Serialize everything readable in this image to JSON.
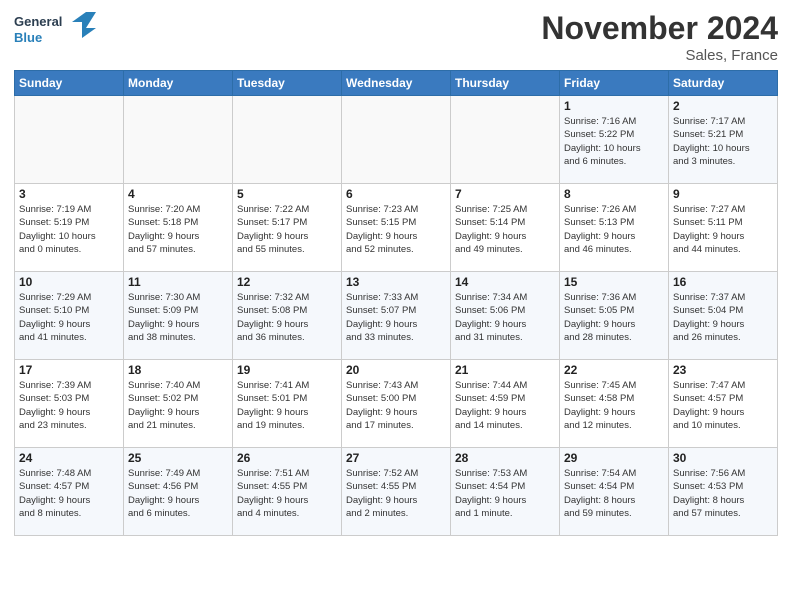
{
  "logo": {
    "line1": "General",
    "line2": "Blue"
  },
  "header": {
    "month": "November 2024",
    "location": "Sales, France"
  },
  "weekdays": [
    "Sunday",
    "Monday",
    "Tuesday",
    "Wednesday",
    "Thursday",
    "Friday",
    "Saturday"
  ],
  "weeks": [
    [
      {
        "day": "",
        "info": ""
      },
      {
        "day": "",
        "info": ""
      },
      {
        "day": "",
        "info": ""
      },
      {
        "day": "",
        "info": ""
      },
      {
        "day": "",
        "info": ""
      },
      {
        "day": "1",
        "info": "Sunrise: 7:16 AM\nSunset: 5:22 PM\nDaylight: 10 hours\nand 6 minutes."
      },
      {
        "day": "2",
        "info": "Sunrise: 7:17 AM\nSunset: 5:21 PM\nDaylight: 10 hours\nand 3 minutes."
      }
    ],
    [
      {
        "day": "3",
        "info": "Sunrise: 7:19 AM\nSunset: 5:19 PM\nDaylight: 10 hours\nand 0 minutes."
      },
      {
        "day": "4",
        "info": "Sunrise: 7:20 AM\nSunset: 5:18 PM\nDaylight: 9 hours\nand 57 minutes."
      },
      {
        "day": "5",
        "info": "Sunrise: 7:22 AM\nSunset: 5:17 PM\nDaylight: 9 hours\nand 55 minutes."
      },
      {
        "day": "6",
        "info": "Sunrise: 7:23 AM\nSunset: 5:15 PM\nDaylight: 9 hours\nand 52 minutes."
      },
      {
        "day": "7",
        "info": "Sunrise: 7:25 AM\nSunset: 5:14 PM\nDaylight: 9 hours\nand 49 minutes."
      },
      {
        "day": "8",
        "info": "Sunrise: 7:26 AM\nSunset: 5:13 PM\nDaylight: 9 hours\nand 46 minutes."
      },
      {
        "day": "9",
        "info": "Sunrise: 7:27 AM\nSunset: 5:11 PM\nDaylight: 9 hours\nand 44 minutes."
      }
    ],
    [
      {
        "day": "10",
        "info": "Sunrise: 7:29 AM\nSunset: 5:10 PM\nDaylight: 9 hours\nand 41 minutes."
      },
      {
        "day": "11",
        "info": "Sunrise: 7:30 AM\nSunset: 5:09 PM\nDaylight: 9 hours\nand 38 minutes."
      },
      {
        "day": "12",
        "info": "Sunrise: 7:32 AM\nSunset: 5:08 PM\nDaylight: 9 hours\nand 36 minutes."
      },
      {
        "day": "13",
        "info": "Sunrise: 7:33 AM\nSunset: 5:07 PM\nDaylight: 9 hours\nand 33 minutes."
      },
      {
        "day": "14",
        "info": "Sunrise: 7:34 AM\nSunset: 5:06 PM\nDaylight: 9 hours\nand 31 minutes."
      },
      {
        "day": "15",
        "info": "Sunrise: 7:36 AM\nSunset: 5:05 PM\nDaylight: 9 hours\nand 28 minutes."
      },
      {
        "day": "16",
        "info": "Sunrise: 7:37 AM\nSunset: 5:04 PM\nDaylight: 9 hours\nand 26 minutes."
      }
    ],
    [
      {
        "day": "17",
        "info": "Sunrise: 7:39 AM\nSunset: 5:03 PM\nDaylight: 9 hours\nand 23 minutes."
      },
      {
        "day": "18",
        "info": "Sunrise: 7:40 AM\nSunset: 5:02 PM\nDaylight: 9 hours\nand 21 minutes."
      },
      {
        "day": "19",
        "info": "Sunrise: 7:41 AM\nSunset: 5:01 PM\nDaylight: 9 hours\nand 19 minutes."
      },
      {
        "day": "20",
        "info": "Sunrise: 7:43 AM\nSunset: 5:00 PM\nDaylight: 9 hours\nand 17 minutes."
      },
      {
        "day": "21",
        "info": "Sunrise: 7:44 AM\nSunset: 4:59 PM\nDaylight: 9 hours\nand 14 minutes."
      },
      {
        "day": "22",
        "info": "Sunrise: 7:45 AM\nSunset: 4:58 PM\nDaylight: 9 hours\nand 12 minutes."
      },
      {
        "day": "23",
        "info": "Sunrise: 7:47 AM\nSunset: 4:57 PM\nDaylight: 9 hours\nand 10 minutes."
      }
    ],
    [
      {
        "day": "24",
        "info": "Sunrise: 7:48 AM\nSunset: 4:57 PM\nDaylight: 9 hours\nand 8 minutes."
      },
      {
        "day": "25",
        "info": "Sunrise: 7:49 AM\nSunset: 4:56 PM\nDaylight: 9 hours\nand 6 minutes."
      },
      {
        "day": "26",
        "info": "Sunrise: 7:51 AM\nSunset: 4:55 PM\nDaylight: 9 hours\nand 4 minutes."
      },
      {
        "day": "27",
        "info": "Sunrise: 7:52 AM\nSunset: 4:55 PM\nDaylight: 9 hours\nand 2 minutes."
      },
      {
        "day": "28",
        "info": "Sunrise: 7:53 AM\nSunset: 4:54 PM\nDaylight: 9 hours\nand 1 minute."
      },
      {
        "day": "29",
        "info": "Sunrise: 7:54 AM\nSunset: 4:54 PM\nDaylight: 8 hours\nand 59 minutes."
      },
      {
        "day": "30",
        "info": "Sunrise: 7:56 AM\nSunset: 4:53 PM\nDaylight: 8 hours\nand 57 minutes."
      }
    ]
  ]
}
